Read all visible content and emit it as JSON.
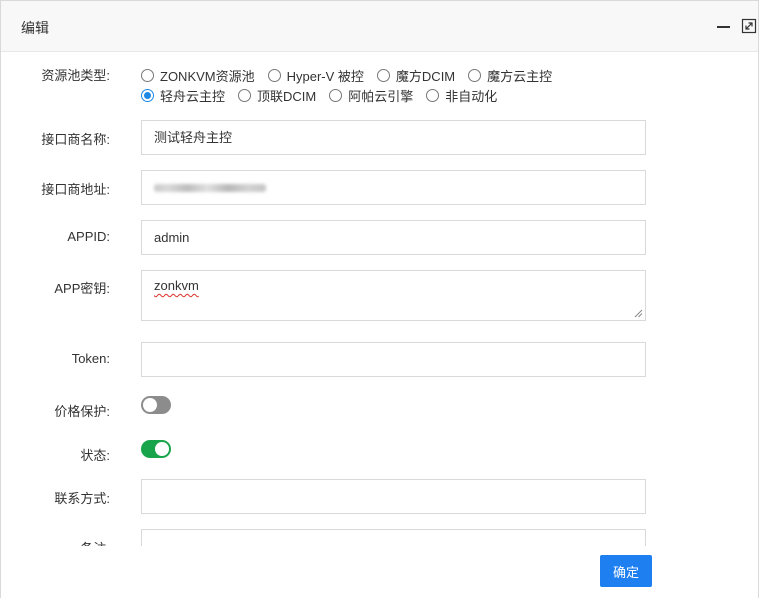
{
  "dialog": {
    "title": "编辑"
  },
  "form": {
    "pool_type": {
      "label": "资源池类型:",
      "options": [
        {
          "label": "ZONKVM资源池",
          "checked": false
        },
        {
          "label": "Hyper-V 被控",
          "checked": false
        },
        {
          "label": "魔方DCIM",
          "checked": false
        },
        {
          "label": "魔方云主控",
          "checked": false
        },
        {
          "label": "轻舟云主控",
          "checked": true
        },
        {
          "label": "顶联DCIM",
          "checked": false
        },
        {
          "label": "阿帕云引擎",
          "checked": false
        },
        {
          "label": "非自动化",
          "checked": false
        }
      ]
    },
    "vendor_name": {
      "label": "接口商名称:",
      "value": "测试轻舟主控"
    },
    "vendor_address": {
      "label": "接口商地址:",
      "value": ""
    },
    "appid": {
      "label": "APPID:",
      "value": "admin"
    },
    "app_key": {
      "label": "APP密钥:",
      "value": "zonkvm"
    },
    "token": {
      "label": "Token:",
      "value": ""
    },
    "price_protect": {
      "label": "价格保护:",
      "enabled": false
    },
    "status": {
      "label": "状态:",
      "enabled": true
    },
    "contact": {
      "label": "联系方式:",
      "value": ""
    },
    "remark": {
      "label": "备注:"
    }
  },
  "footer": {
    "confirm_label": "确定"
  },
  "colors": {
    "accent": "#1e7ff0",
    "toggle_on": "#18a44a",
    "toggle_off": "#8c8c8c"
  }
}
